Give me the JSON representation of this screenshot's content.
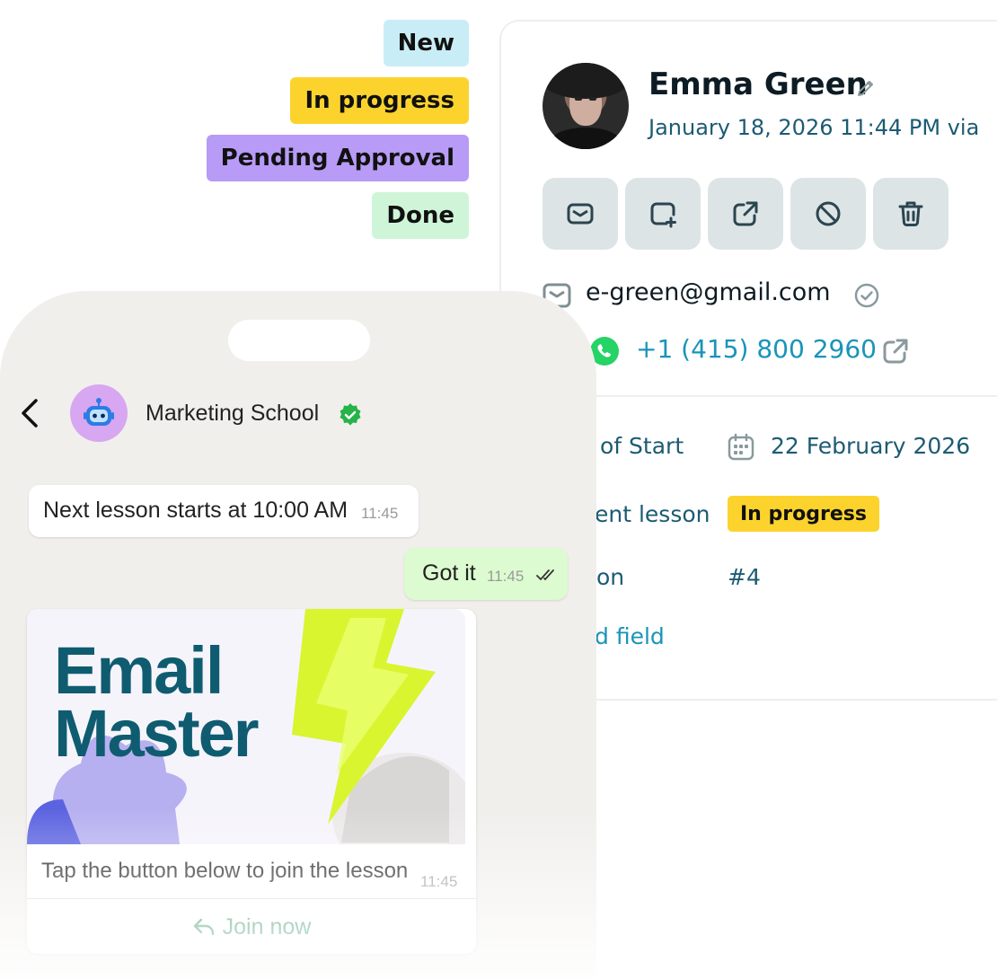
{
  "status_tags": {
    "new": "New",
    "in_progress": "In progress",
    "pending_approval": "Pending Approval",
    "done": "Done"
  },
  "contact": {
    "name": "Emma Green",
    "datetime": "January 18, 2026 11:44 PM via",
    "email": "e-green@gmail.com",
    "phone": "+1 (415) 800 2960",
    "actions": [
      "mail-icon",
      "add-task-icon",
      "open-external-icon",
      "block-icon",
      "trash-icon"
    ]
  },
  "fields": {
    "start_label": "of Start",
    "start_value": "22 February 2026",
    "current_lesson_label": "ent lesson",
    "current_lesson_value": "In progress",
    "lesson_label": "on",
    "lesson_value": "#4",
    "add_field": "d field"
  },
  "chat": {
    "title": "Marketing School",
    "messages": [
      {
        "text": "Next lesson starts at 10:00 AM",
        "time": "11:45"
      },
      {
        "text": "Got it",
        "time": "11:45"
      }
    ],
    "banner_title": "Email\nMaster",
    "caption": "Tap the button below to join the lesson",
    "caption_time": "11:45",
    "button": "Join now"
  },
  "colors": {
    "new": "#c9edf7",
    "in_progress": "#fcd32d",
    "pending": "#b89bf6",
    "done": "#cff5d8",
    "accent_teal": "#1994b9",
    "whatsapp_green": "#25d366",
    "outgoing_bubble": "#dcfbd0"
  }
}
